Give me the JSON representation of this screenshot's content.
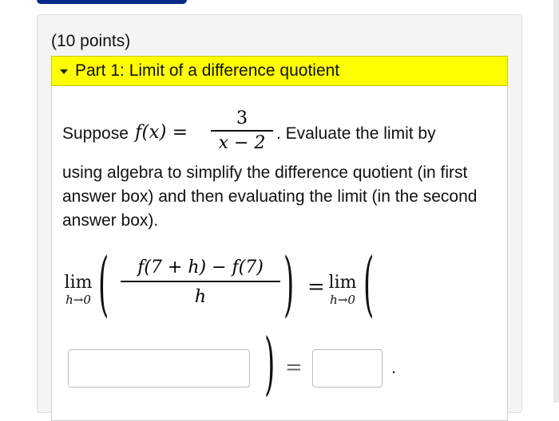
{
  "question": {
    "points_label": "(10 points)",
    "part_title": "Part 1: Limit of a difference quotient",
    "prompt_prefix": "Suppose",
    "function_lhs": "f(x) =",
    "function_numerator": "3",
    "function_denominator": "x − 2",
    "prompt_suffix": ". Evaluate the limit by",
    "instructions": "using algebra to simplify the difference quotient (in first answer box) and then evaluating the limit (in the second answer box).",
    "limit_text": "lim",
    "limit_sub": "h→0",
    "dq_numerator": "f(7 + h) − f(7)",
    "dq_denominator": "h",
    "equals": "=",
    "final_period": "."
  },
  "answers": {
    "simplified_quotient": "",
    "limit_value": ""
  }
}
